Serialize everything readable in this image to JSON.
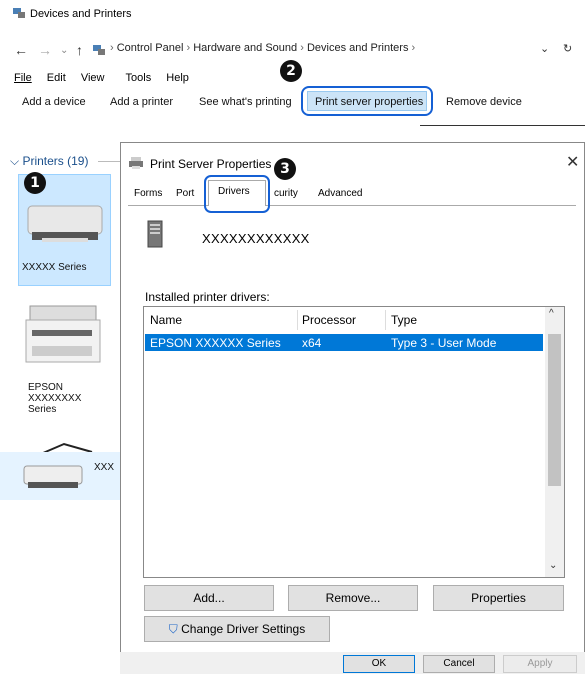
{
  "window": {
    "title": "Devices and Printers",
    "address": [
      "Control Panel",
      "Hardware and Sound",
      "Devices and Printers"
    ],
    "menu": [
      "File",
      "Edit",
      "View",
      "Tools",
      "Help"
    ],
    "toolbar": {
      "add_device": "Add a device",
      "add_printer": "Add a printer",
      "see_printing": "See what's printing",
      "print_server": "Print server properties",
      "remove_device": "Remove device"
    }
  },
  "left_pane": {
    "group_label": "Printers (19)",
    "devices": [
      {
        "label": "XXXXX Series"
      },
      {
        "label": "EPSON\nXXXXXXXX\nSeries"
      },
      {
        "label": "XXX"
      }
    ]
  },
  "dialog": {
    "title": "Print Server Properties",
    "tabs": [
      "Forms",
      "Port",
      "Drivers",
      "curity",
      "Advanced"
    ],
    "active_tab": "Drivers",
    "server_name": "XXXXXXXXXXXX",
    "section_label": "Installed printer drivers:",
    "columns": [
      "Name",
      "Processor",
      "Type"
    ],
    "rows": [
      {
        "name": "EPSON XXXXXX Series",
        "processor": "x64",
        "type": "Type 3 - User Mode"
      }
    ],
    "buttons": {
      "add": "Add...",
      "remove": "Remove...",
      "properties": "Properties",
      "change_settings": "Change Driver Settings",
      "ok": "OK",
      "cancel": "Cancel",
      "apply": "Apply"
    }
  },
  "callouts": [
    "1",
    "2",
    "3"
  ],
  "colors": {
    "highlight": "#1560d4",
    "selection": "#0078d7"
  }
}
